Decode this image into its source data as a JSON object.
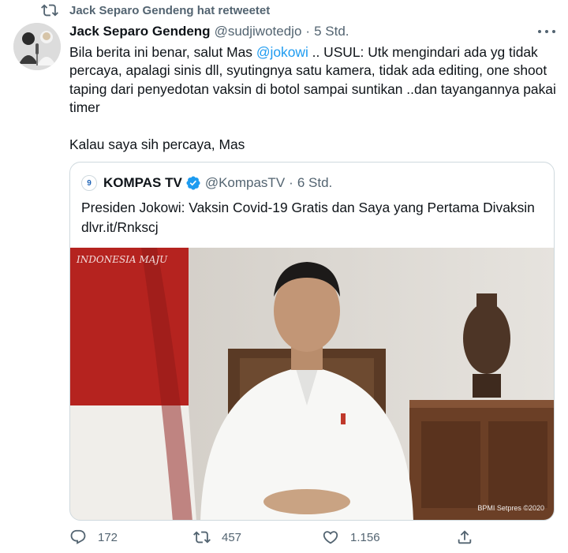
{
  "retweet": {
    "label": "Jack Separo Gendeng hat retweetet",
    "icon": "retweet-icon"
  },
  "tweet": {
    "author_name": "Jack Separo Gendeng",
    "author_handle": "@sudjiwotedjo",
    "separator": "·",
    "time": "5 Std.",
    "text_before_mention": "Bila berita ini benar, salut Mas ",
    "mention": "@jokowi",
    "text_after_mention": " .. USUL: Utk mengindari ada yg tidak percaya, apalagi sinis dll, syutingnya satu kamera, tidak ada editing, one shoot taping dari penyedotan vaksin di botol sampai suntikan ..dan tayangannya pakai timer\n\nKalau saya sih percaya, Mas",
    "more_icon": "more-icon"
  },
  "quoted": {
    "logo_text": "9",
    "name": "KOMPAS TV",
    "handle": "@KompasTV",
    "separator": "·",
    "time": "6 Std.",
    "text": "Presiden Jokowi: Vaksin Covid-19 Gratis dan Saya yang Pertama Divaksin dlvr.it/Rnkscj",
    "image": {
      "watermark": "INDONESIA MAJU",
      "credit": "BPMI Setpres ©2020"
    }
  },
  "actions": {
    "reply_count": "172",
    "retweet_count": "457",
    "like_count": "1.156"
  },
  "colors": {
    "accent": "#1d9bf0",
    "secondary_text": "#536471",
    "border": "#cfd9de"
  }
}
